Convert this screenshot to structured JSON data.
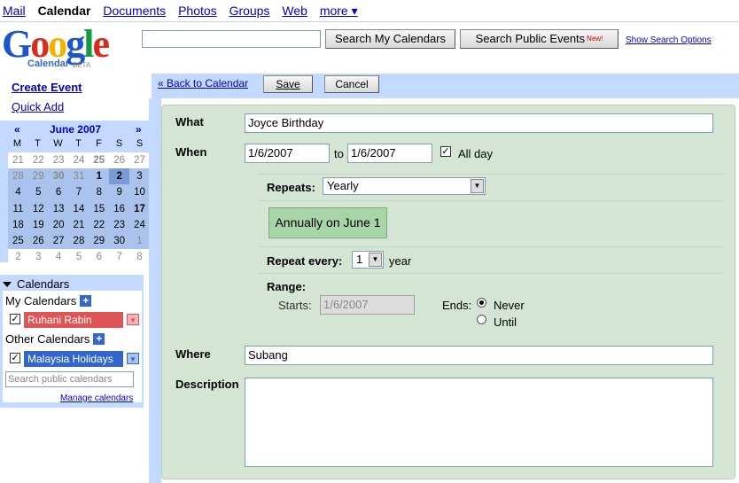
{
  "topnav": [
    "Mail",
    "Calendar",
    "Documents",
    "Photos",
    "Groups",
    "Web",
    "more ▾"
  ],
  "logo": {
    "word": "Google",
    "product": "Calendar",
    "beta": "BETA"
  },
  "search": {
    "my_label": "Search My Calendars",
    "public_label": "Search Public Events",
    "new_badge": "New!",
    "options_label": "Show Search Options"
  },
  "sidebar": {
    "create_event": "Create Event",
    "quick_add": "Quick Add",
    "minical": {
      "prev": "«",
      "next": "»",
      "title": "June 2007",
      "days_of_week": [
        "M",
        "T",
        "W",
        "T",
        "F",
        "S",
        "S"
      ],
      "weeks": [
        [
          "21",
          "22",
          "23",
          "24",
          "25",
          "26",
          "27"
        ],
        [
          "28",
          "29",
          "30",
          "31",
          "1",
          "2",
          "3"
        ],
        [
          "4",
          "5",
          "6",
          "7",
          "8",
          "9",
          "10"
        ],
        [
          "11",
          "12",
          "13",
          "14",
          "15",
          "16",
          "17"
        ],
        [
          "18",
          "19",
          "20",
          "21",
          "22",
          "23",
          "24"
        ],
        [
          "25",
          "26",
          "27",
          "28",
          "29",
          "30",
          "1"
        ],
        [
          "2",
          "3",
          "4",
          "5",
          "6",
          "7",
          "8"
        ]
      ]
    },
    "calendars": {
      "title": "Calendars",
      "my_label": "My Calendars",
      "other_label": "Other Calendars",
      "my_items": [
        {
          "name": "Ruhani Rabin",
          "color": "#dd5555"
        }
      ],
      "other_items": [
        {
          "name": "Malaysia Holidays",
          "color": "#3366cc"
        }
      ],
      "search_placeholder": "Search public calendars",
      "manage": "Manage calendars"
    }
  },
  "toolbar": {
    "back": "« Back to Calendar",
    "save": "Save",
    "cancel": "Cancel"
  },
  "form": {
    "what_label": "What",
    "what_value": "Joyce Birthday",
    "when_label": "When",
    "start_date": "1/6/2007",
    "to_label": "to",
    "end_date": "1/6/2007",
    "allday_label": "All day",
    "repeats_label": "Repeats:",
    "repeats_value": "Yearly",
    "summary": "Annually on June 1",
    "repeat_every_label": "Repeat every:",
    "repeat_every_value": "1",
    "repeat_unit": "year",
    "range_label": "Range:",
    "starts_label": "Starts:",
    "starts_value": "1/6/2007",
    "ends_label": "Ends:",
    "never_label": "Never",
    "until_label": "Until",
    "where_label": "Where",
    "where_value": "Subang",
    "description_label": "Description"
  },
  "colors": {
    "accent_blue": "#c3d9ff",
    "panel_green": "#d4e5d4",
    "summary_green": "#a8d5a8"
  }
}
